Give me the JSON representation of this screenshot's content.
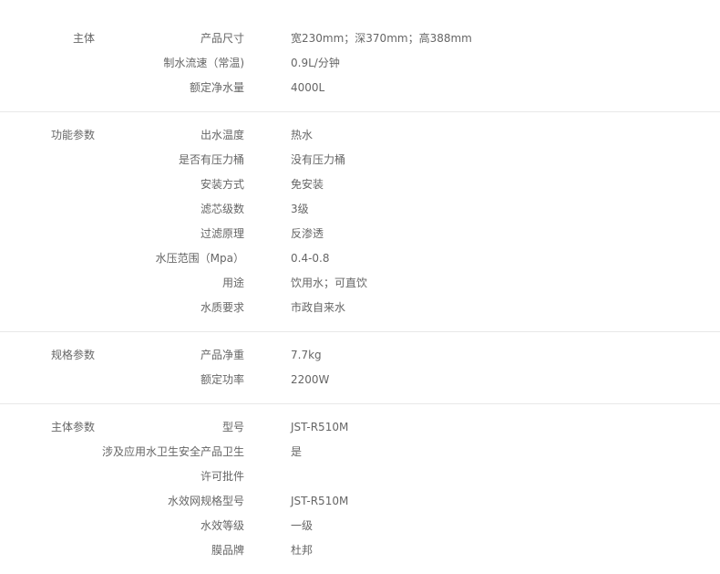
{
  "sections": [
    {
      "title": "主体",
      "rows": [
        {
          "key": "产品尺寸",
          "value": "宽230mm；深370mm；高388mm"
        },
        {
          "key": "制水流速（常温)",
          "value": "0.9L/分钟"
        },
        {
          "key": "额定净水量",
          "value": "4000L"
        }
      ]
    },
    {
      "title": "功能参数",
      "rows": [
        {
          "key": "出水温度",
          "value": "热水"
        },
        {
          "key": "是否有压力桶",
          "value": "没有压力桶"
        },
        {
          "key": "安装方式",
          "value": "免安装"
        },
        {
          "key": "滤芯级数",
          "value": "3级"
        },
        {
          "key": "过滤原理",
          "value": "反渗透"
        },
        {
          "key": "水压范围（Mpa）",
          "value": "0.4-0.8"
        },
        {
          "key": "用途",
          "value": "饮用水；可直饮"
        },
        {
          "key": "水质要求",
          "value": "市政自来水"
        }
      ]
    },
    {
      "title": "规格参数",
      "rows": [
        {
          "key": "产品净重",
          "value": "7.7kg"
        },
        {
          "key": "额定功率",
          "value": "2200W"
        }
      ]
    },
    {
      "title": "主体参数",
      "rows": [
        {
          "key": "型号",
          "value": "JST-R510M"
        },
        {
          "key": "涉及应用水卫生安全产品卫生",
          "value": "是"
        },
        {
          "key": "许可批件",
          "value": ""
        },
        {
          "key": "水效网规格型号",
          "value": "JST-R510M"
        },
        {
          "key": "水效等级",
          "value": "一级"
        },
        {
          "key": "膜品牌",
          "value": "杜邦"
        }
      ]
    }
  ]
}
